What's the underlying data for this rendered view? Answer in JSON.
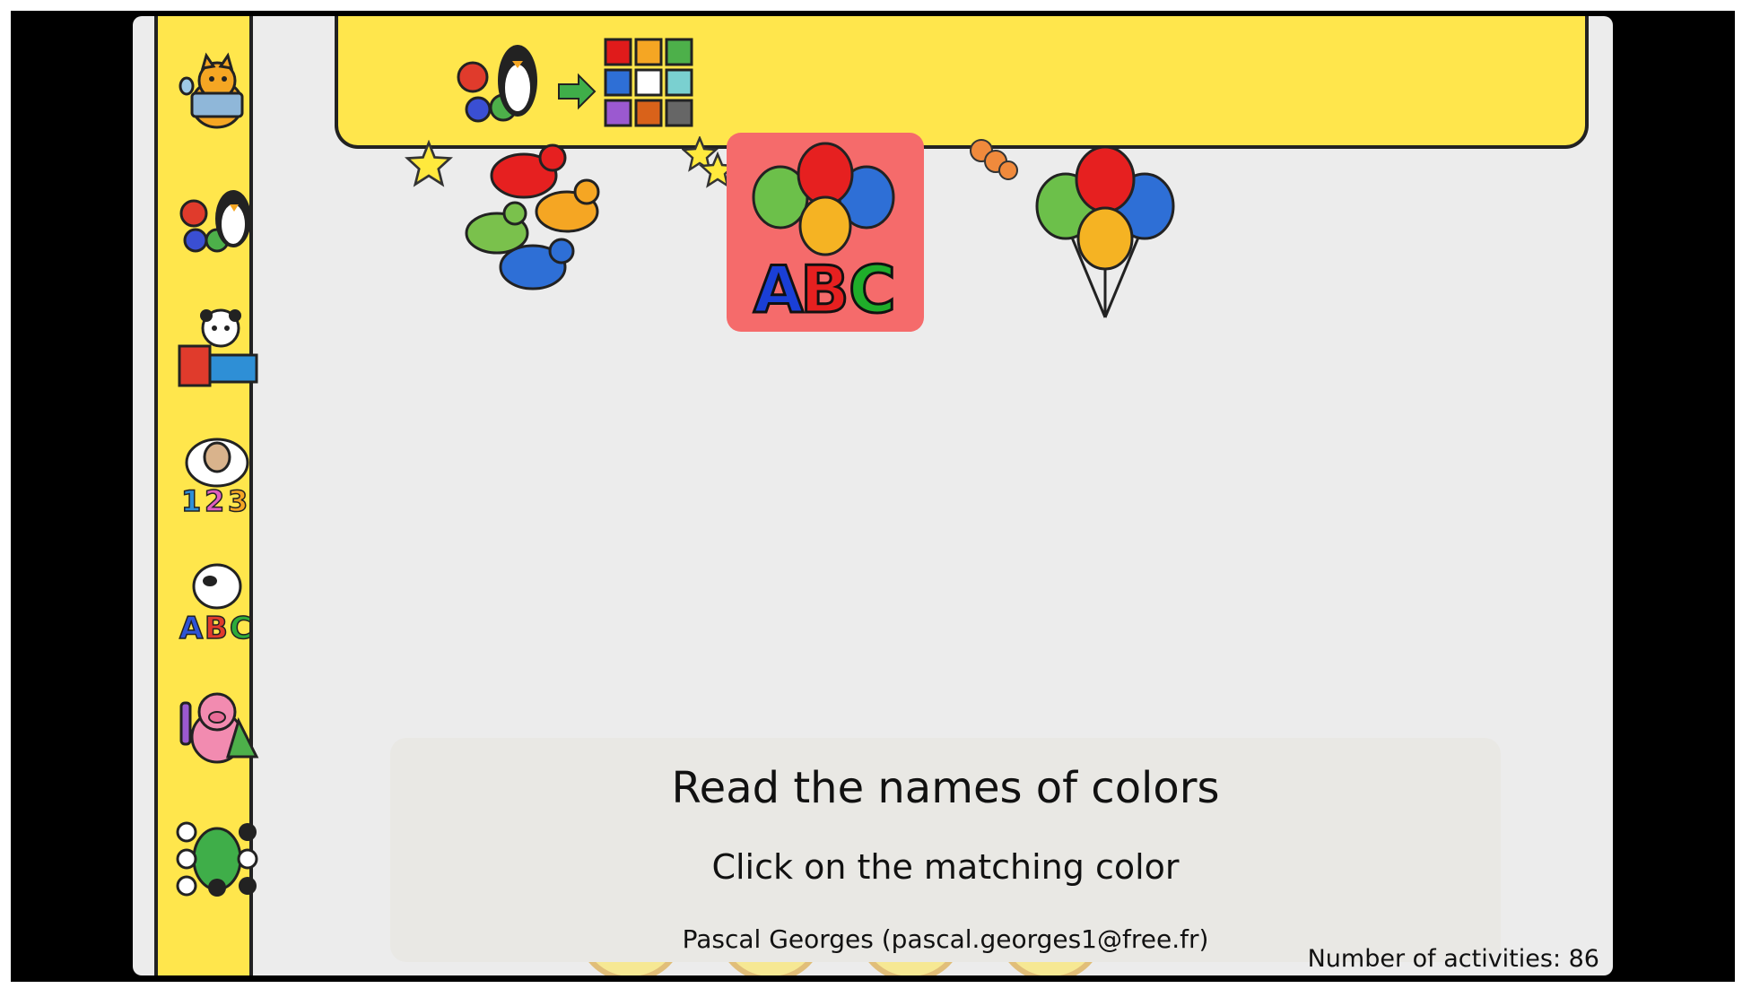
{
  "sidebar": {
    "items": [
      {
        "icon": "cat-computer-icon",
        "label": ""
      },
      {
        "icon": "penguin-gears-icon",
        "label": ""
      },
      {
        "icon": "panda-puzzle-icon",
        "label": ""
      },
      {
        "icon": "sheep-123-icon",
        "label": ""
      },
      {
        "icon": "cow-abc-icon",
        "label": ""
      },
      {
        "icon": "pig-science-icon",
        "label": ""
      },
      {
        "icon": "frog-board-game-icon",
        "label": ""
      }
    ]
  },
  "topbar": {
    "section_icon": "penguin-gears-color-grid-icon"
  },
  "colors": {
    "sidebar_bg": "#ffe64c",
    "selected_bg": "#f56b6b",
    "panel_bg": "#e9e8e4"
  },
  "activities": [
    {
      "icon": "birds-icon",
      "selected": false
    },
    {
      "icon": "balloons-abc-icon",
      "selected": true
    },
    {
      "icon": "balloons-icon",
      "selected": false
    }
  ],
  "info": {
    "title": "Read the names of colors",
    "description": "Click on the matching color",
    "author": "Pascal Georges (pascal.georges1@free.fr)"
  },
  "controls": [
    {
      "icon": "power-icon"
    },
    {
      "icon": "about-icon"
    },
    {
      "icon": "settings-wrench-icon"
    },
    {
      "icon": "help-icon"
    }
  ],
  "status": {
    "activities_count_label": "Number of activities: 86"
  }
}
